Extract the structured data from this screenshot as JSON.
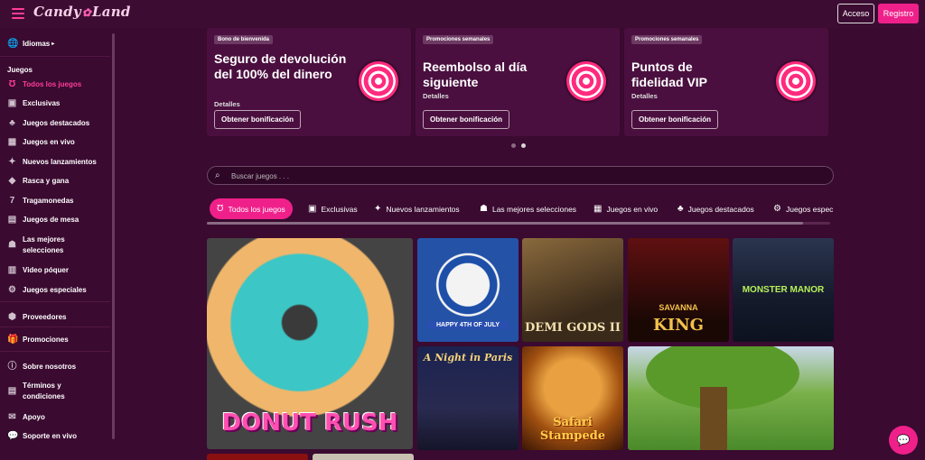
{
  "header": {
    "logo_text": "Candy",
    "logo_text2": "Land",
    "login_label": "Acceso",
    "register_label": "Registro"
  },
  "sidebar": {
    "language_label": "Idiomas",
    "section_heading": "Juegos",
    "items": [
      {
        "label": "Todos los juegos",
        "icon": "horseshoe-icon"
      },
      {
        "label": "Exclusivas",
        "icon": "exclusive-icon"
      },
      {
        "label": "Juegos destacados",
        "icon": "featured-icon"
      },
      {
        "label": "Juegos en vivo",
        "icon": "live-icon"
      },
      {
        "label": "Nuevos lanzamientos",
        "icon": "new-icon"
      },
      {
        "label": "Rasca y gana",
        "icon": "scratch-icon"
      },
      {
        "label": "Tragamonedas",
        "icon": "slots-icon"
      },
      {
        "label": "Juegos de mesa",
        "icon": "table-games-icon"
      },
      {
        "label": "Las mejores selecciones",
        "icon": "best-picks-icon"
      },
      {
        "label": "Video póquer",
        "icon": "video-poker-icon"
      },
      {
        "label": "Juegos especiales",
        "icon": "special-games-icon"
      }
    ],
    "providers_label": "Proveedores",
    "promotions_label": "Promociones",
    "about_label": "Sobre nosotros",
    "terms_label": "Términos y condiciones",
    "support_label": "Apoyo",
    "live_support_label": "Soporte en vivo"
  },
  "promos": [
    {
      "tag": "Bono de bienvenida",
      "title": "Seguro de devolución del 100% del dinero",
      "details": "Detalles",
      "cta": "Obtener bonificación"
    },
    {
      "tag": "Promociones semanales",
      "title": "Reembolso al día siguiente",
      "details": "Detalles",
      "cta": "Obtener bonificación"
    },
    {
      "tag": "Promociones semanales",
      "title": "Puntos de fidelidad VIP",
      "details": "Detalles",
      "cta": "Obtener bonificación"
    }
  ],
  "search": {
    "placeholder": "Buscar juegos . . ."
  },
  "tabs": [
    {
      "label": "Todos los juegos",
      "icon": "horseshoe-icon"
    },
    {
      "label": "Exclusivas",
      "icon": "exclusive-icon"
    },
    {
      "label": "Nuevos lanzamientos",
      "icon": "new-icon"
    },
    {
      "label": "Las mejores selecciones",
      "icon": "best-picks-icon"
    },
    {
      "label": "Juegos en vivo",
      "icon": "live-icon"
    },
    {
      "label": "Juegos destacados",
      "icon": "featured-icon"
    },
    {
      "label": "Juegos espec",
      "icon": "gear-icon"
    }
  ],
  "games": {
    "donut": "DONUT RUSH",
    "july": "HAPPY 4TH OF JULY",
    "demi": "DEMI GODS II",
    "king_sub": "SAVANNA",
    "king": "KING",
    "manor": "MONSTER MANOR",
    "paris": "A Night in Paris",
    "safari": "Safari Stampede"
  },
  "colors": {
    "accent": "#f0208a",
    "background": "#3a0a30",
    "card": "#4a0f3f"
  }
}
